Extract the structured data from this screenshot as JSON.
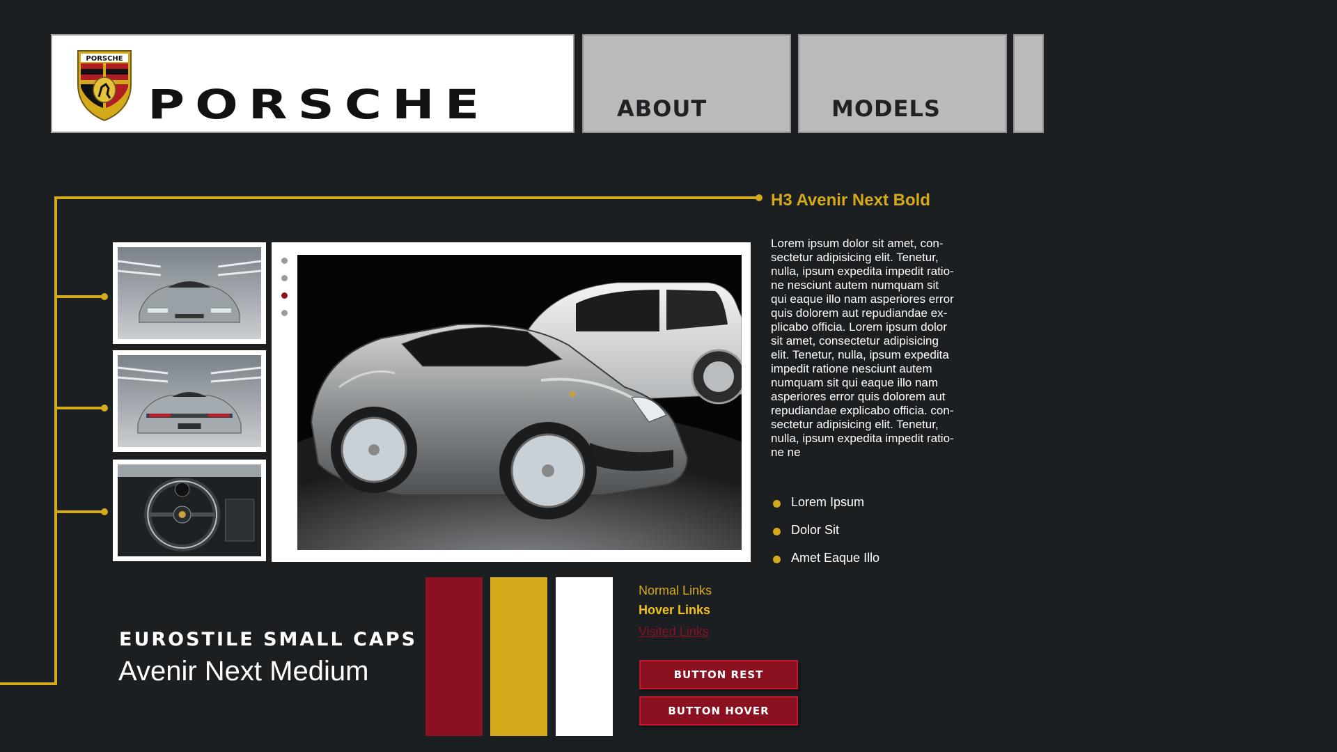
{
  "header": {
    "brand_crest_text": "PORSCHE",
    "brand_wordmark": "PORSCHE",
    "nav": [
      {
        "label": "ABOUT"
      },
      {
        "label": "MODELS"
      },
      {
        "label": ""
      }
    ]
  },
  "gallery": {
    "thumbnails": [
      {
        "icon": "car-front-thumbnail"
      },
      {
        "icon": "car-rear-thumbnail"
      },
      {
        "icon": "steering-wheel-thumbnail"
      }
    ],
    "pager_dots": 4,
    "active_dot": 3,
    "main_image": "silver-porsche-918-spyder-photo"
  },
  "content": {
    "heading": "H3 Avenir Next Bold",
    "body": "Lorem ipsum dolor sit amet, con-\nsectetur adipisicing elit. Tenetur,\nnulla, ipsum expedita impedit ratio-\nne nesciunt autem numquam sit\nqui eaque illo nam asperiores error\nquis dolorem aut repudiandae ex-\nplicabo officia. Lorem ipsum dolor\nsit amet, consectetur adipisicing\nelit. Tenetur, nulla, ipsum expedita\nimpedit ratione nesciunt autem\nnumquam sit qui eaque illo nam\nasperiores error quis dolorem aut\nrepudiandae explicabo officia. con-\nsectetur adipisicing elit. Tenetur,\nnulla, ipsum expedita impedit ratio-\nne ne",
    "bullets": [
      "Lorem Ipsum",
      "Dolor Sit",
      "Amet Eaque Illo"
    ]
  },
  "fonts": {
    "caps_sample": "EUROSTILE SMALL CAPS",
    "medium_sample": "Avenir Next Medium"
  },
  "palette": {
    "swatches": [
      "#8b1120",
      "#d4a91a",
      "#ffffff"
    ],
    "accent": "#d4a91a",
    "background": "#1c1f22"
  },
  "links": {
    "normal": "Normal Links",
    "hover": "Hover Links",
    "visited": "Visited Links",
    "normal_color": "#d4a91a",
    "hover_color": "#f2c21f",
    "visited_color": "#8b1120"
  },
  "buttons": {
    "rest": "BUTTON REST",
    "hover": "BUTTON HOVER"
  }
}
